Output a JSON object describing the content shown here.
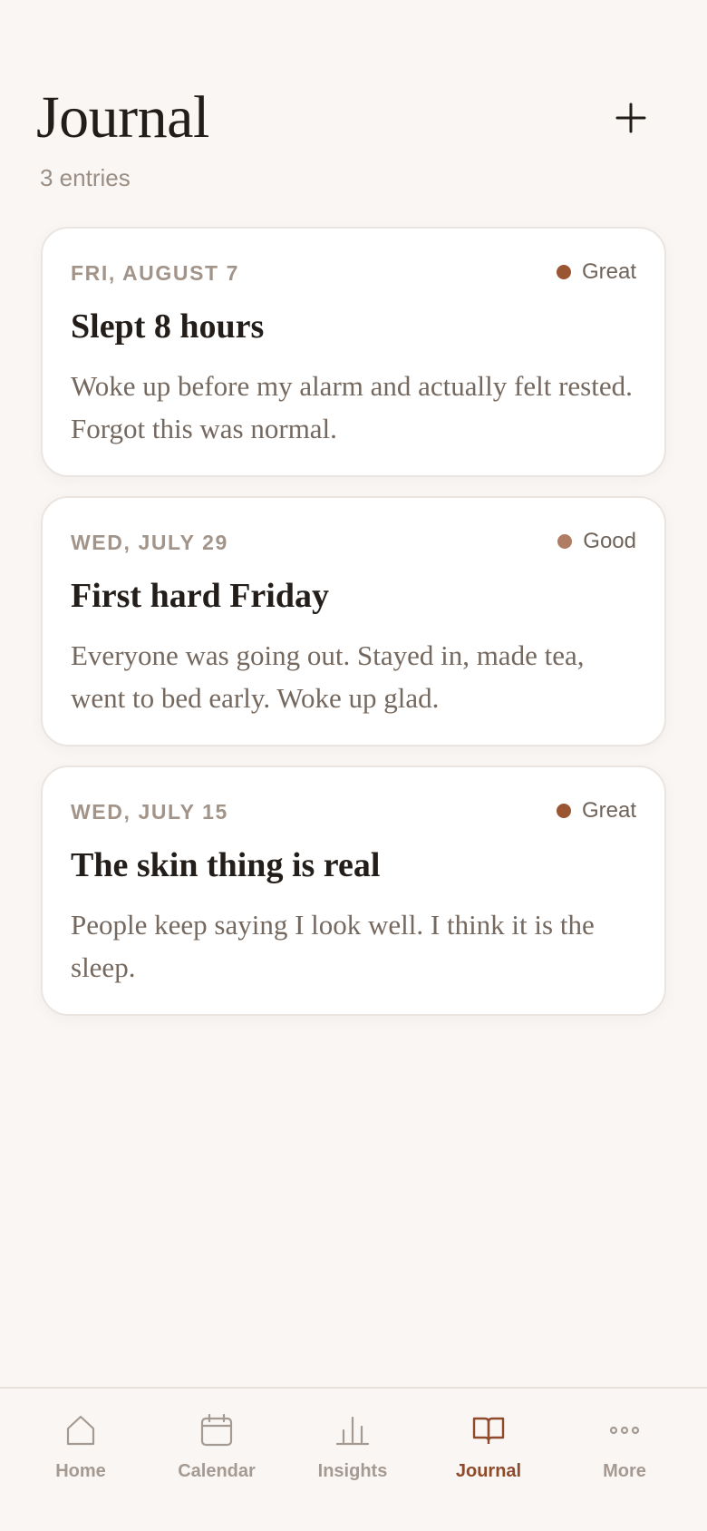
{
  "header": {
    "title": "Journal",
    "subtitle": "3 entries",
    "add_icon": "plus-icon"
  },
  "entries": [
    {
      "date": "FRI, AUGUST 7",
      "mood": "Great",
      "mood_color": "#9a5633",
      "title": "Slept 8 hours",
      "body": "Woke up before my alarm and actually felt rested. Forgot this was normal."
    },
    {
      "date": "WED, JULY 29",
      "mood": "Good",
      "mood_color": "#b07d64",
      "title": "First hard Friday",
      "body": "Everyone was going out. Stayed in, made tea, went to bed early. Woke up glad."
    },
    {
      "date": "WED, JULY 15",
      "mood": "Great",
      "mood_color": "#9a5633",
      "title": "The skin thing is real",
      "body": "People keep saying I look well. I think it is the sleep."
    }
  ],
  "tabbar": {
    "items": [
      {
        "label": "Home",
        "icon": "home-icon"
      },
      {
        "label": "Calendar",
        "icon": "calendar-icon"
      },
      {
        "label": "Insights",
        "icon": "bar-chart-icon"
      },
      {
        "label": "Journal",
        "icon": "book-icon",
        "active": true
      },
      {
        "label": "More",
        "icon": "more-dots-icon"
      }
    ]
  },
  "colors": {
    "background": "#f9f6f4",
    "accent": "#8e4a2a",
    "inactive_tab": "#a59a91"
  }
}
